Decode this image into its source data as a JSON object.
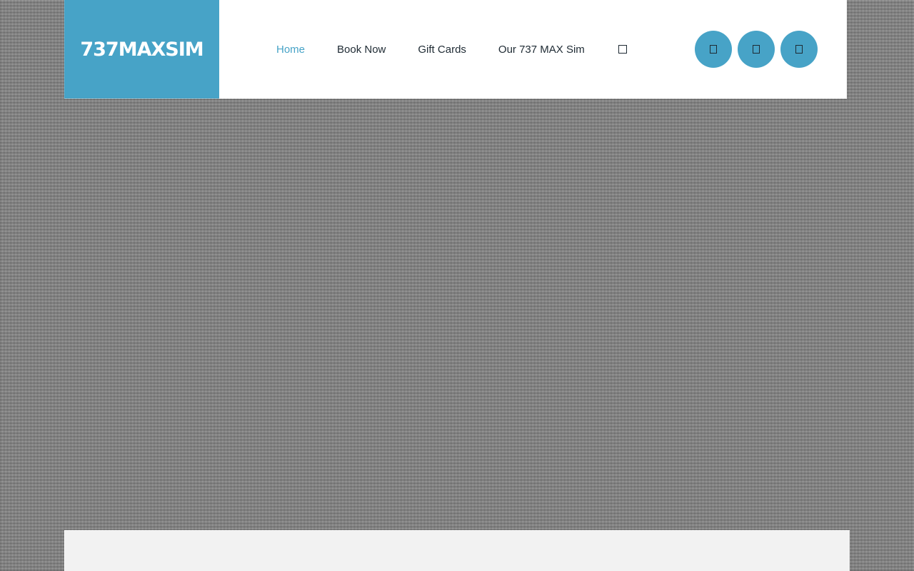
{
  "brand": {
    "logo_text": "737MAXSIM",
    "accent_color": "#47a3c7"
  },
  "nav": {
    "items": [
      {
        "label": "Home",
        "active": true
      },
      {
        "label": "Book Now",
        "active": false
      },
      {
        "label": "Gift Cards",
        "active": false
      },
      {
        "label": "Our 737 MAX Sim",
        "active": false
      }
    ],
    "search_icon": "search-icon"
  },
  "socials": [
    {
      "icon": "social-icon-1"
    },
    {
      "icon": "social-icon-2"
    },
    {
      "icon": "social-icon-3"
    }
  ]
}
